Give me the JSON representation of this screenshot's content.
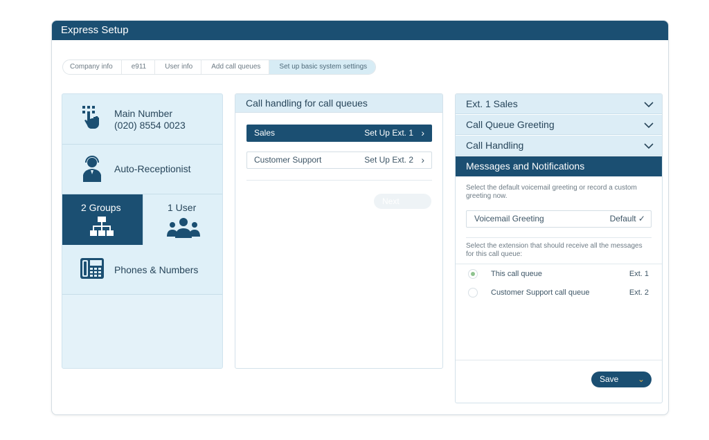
{
  "window": {
    "title": "Express Setup"
  },
  "breadcrumbs": [
    "Company info",
    "e911",
    "User info",
    "Add call queues",
    "Set up basic system settings"
  ],
  "left_panel": {
    "main_number_label": "Main Number",
    "main_number_value": "(020) 8554 0023",
    "auto_receptionist": "Auto-Receptionist",
    "groups": "2 Groups",
    "users": "1 User",
    "phones_numbers": "Phones & Numbers"
  },
  "middle_panel": {
    "title": "Call handling for call queues",
    "queues": [
      {
        "name": "Sales",
        "action": "Set Up Ext. 1"
      },
      {
        "name": "Customer Support",
        "action": "Set Up Ext. 2"
      }
    ],
    "next_label": "Next"
  },
  "right_panel": {
    "sections": [
      {
        "label": "Ext. 1 Sales"
      },
      {
        "label": "Call Queue Greeting"
      },
      {
        "label": "Call Handling"
      },
      {
        "label": "Messages and Notifications"
      }
    ],
    "greeting_hint": "Select the default voicemail greeting or record a custom greeting now.",
    "voicemail_label": "Voicemail Greeting",
    "voicemail_value": "Default ✓",
    "extension_hint": "Select the extension that should receive all the messages for this call queue:",
    "options": [
      {
        "label": "This call queue",
        "ext": "Ext. 1",
        "selected": true
      },
      {
        "label": "Customer Support call queue",
        "ext": "Ext. 2",
        "selected": false
      }
    ],
    "save_label": "Save"
  },
  "colors": {
    "primary": "#1b4f72",
    "panel_bg": "#dff0f8",
    "radio_selected": "#8fc38f"
  }
}
